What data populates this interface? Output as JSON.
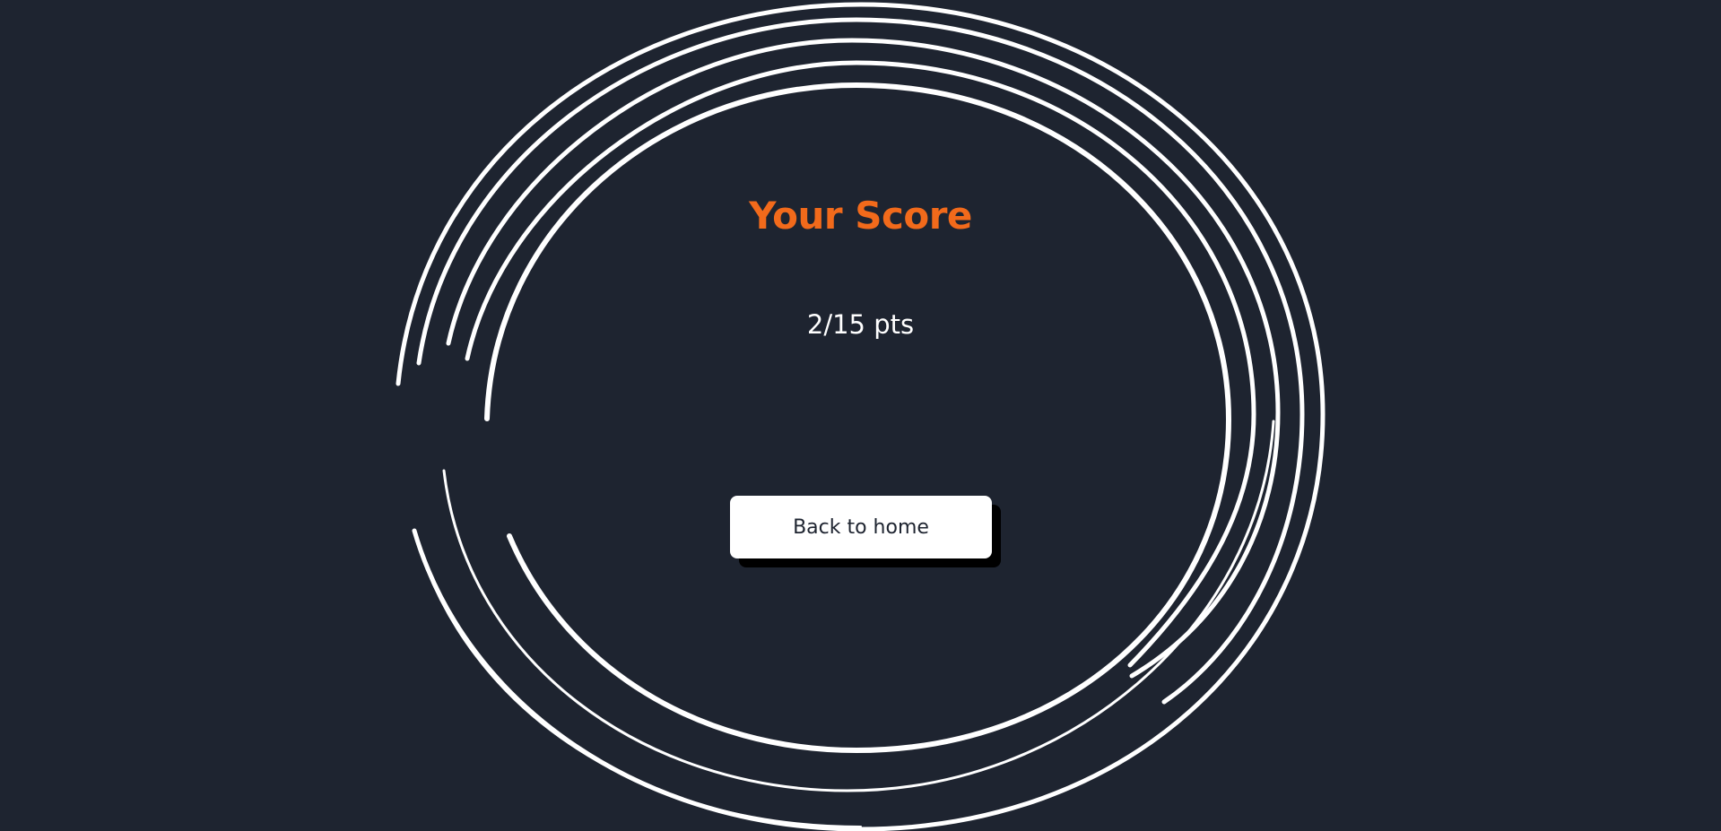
{
  "result": {
    "title": "Your Score",
    "score_text": "2/15 pts",
    "back_button_label": "Back to home"
  },
  "colors": {
    "background": "#1e2430",
    "accent": "#f26a1b",
    "ring": "#ffffff",
    "button_background": "#ffffff",
    "button_shadow": "#000000"
  },
  "decoration": {
    "icon": "hand-drawn-concentric-rings"
  }
}
